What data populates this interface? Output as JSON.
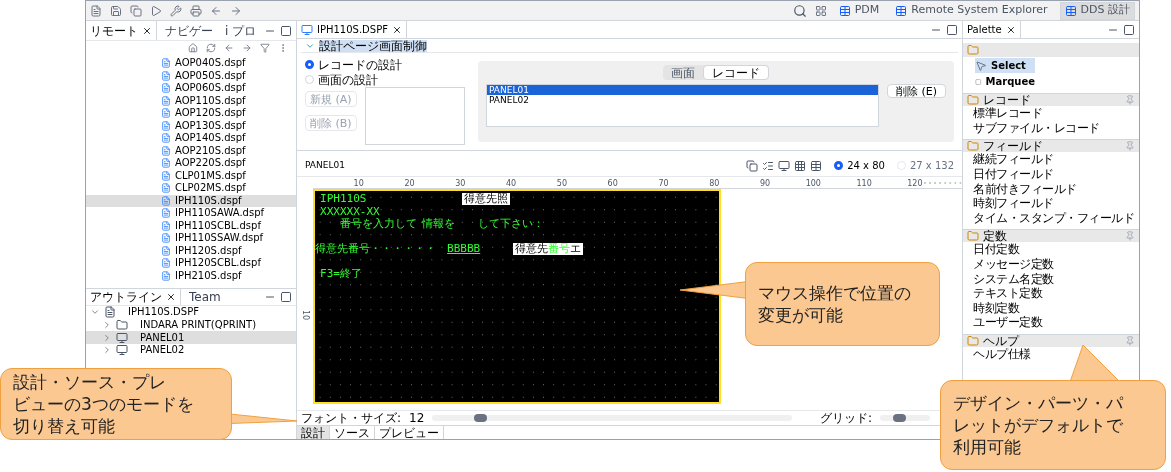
{
  "toolbar": {
    "perspectives": [
      {
        "label": "PDM",
        "selected": false
      },
      {
        "label": "Remote System Explorer",
        "selected": false
      },
      {
        "label": "DDS 設計",
        "selected": true
      }
    ]
  },
  "remote_panel": {
    "tabs": [
      {
        "label": "リモート",
        "selected": true
      },
      {
        "label": "ナビゲー",
        "selected": false
      },
      {
        "label": "i プロ",
        "selected": false
      }
    ],
    "files": [
      {
        "name": "AOP040S.dspf",
        "selected": false
      },
      {
        "name": "AOP050S.dspf",
        "selected": false
      },
      {
        "name": "AOP060S.dspf",
        "selected": false
      },
      {
        "name": "AOP110S.dspf",
        "selected": false
      },
      {
        "name": "AOP120S.dspf",
        "selected": false
      },
      {
        "name": "AOP130S.dspf",
        "selected": false
      },
      {
        "name": "AOP140S.dspf",
        "selected": false
      },
      {
        "name": "AOP210S.dspf",
        "selected": false
      },
      {
        "name": "AOP220S.dspf",
        "selected": false
      },
      {
        "name": "CLP01MS.dspf",
        "selected": false
      },
      {
        "name": "CLP02MS.dspf",
        "selected": false
      },
      {
        "name": "IPH110S.dspf",
        "selected": true
      },
      {
        "name": "IPH110SAWA.dspf",
        "selected": false
      },
      {
        "name": "IPH110SCBL.dspf",
        "selected": false
      },
      {
        "name": "IPH110SSAW.dspf",
        "selected": false
      },
      {
        "name": "IPH120S.dspf",
        "selected": false
      },
      {
        "name": "IPH120SCBL.dspf",
        "selected": false
      },
      {
        "name": "IPH210S.dspf",
        "selected": false
      }
    ]
  },
  "outline_panel": {
    "tabs": [
      {
        "label": "アウトライン",
        "selected": true
      },
      {
        "label": "Team",
        "selected": false
      }
    ],
    "tree": [
      {
        "label": "IPH110S.DSPF",
        "kind": "file",
        "expanded": true,
        "selected": false,
        "children": [
          {
            "label": "INDARA PRINT(QPRINT)",
            "kind": "folder",
            "expanded": false,
            "selected": false
          },
          {
            "label": "PANEL01",
            "kind": "record",
            "expanded": false,
            "selected": true
          },
          {
            "label": "PANEL02",
            "kind": "record",
            "expanded": false,
            "selected": false
          }
        ]
      }
    ]
  },
  "editor": {
    "tab": "IPH110S.DSPF",
    "section_title": "設計ページ画面制御",
    "design_modes": [
      {
        "label": "レコードの設計",
        "selected": true
      },
      {
        "label": "画面の設計",
        "selected": false
      }
    ],
    "left_buttons": [
      {
        "label": "新規 (A)",
        "disabled": true
      },
      {
        "label": "削除 (B)",
        "disabled": true
      }
    ],
    "view_tabs": [
      {
        "label": "画面",
        "selected": false
      },
      {
        "label": "レコード",
        "selected": true
      }
    ],
    "records": [
      {
        "name": "PANEL01",
        "selected": true
      },
      {
        "name": "PANEL02",
        "selected": false
      }
    ],
    "delete_button": "削除 (E)",
    "record_name": "PANEL01",
    "screen_sizes": [
      {
        "label": "24 x 80",
        "selected": true,
        "disabled": false
      },
      {
        "label": "27 x 132",
        "selected": false,
        "disabled": true
      }
    ],
    "ruler_labels": [
      "10",
      "20",
      "30",
      "40",
      "50",
      "60",
      "70",
      "80",
      "90",
      "100",
      "110",
      "120"
    ],
    "vertical_ruler_label": "10",
    "screen_fields": [
      {
        "text": "IPH110S",
        "kind": "constant"
      },
      {
        "text": "得意先照",
        "kind": "highlighted"
      },
      {
        "text": "XXXXXX-XX",
        "kind": "constant"
      },
      {
        "text": "番号を入力して",
        "kind": "constant"
      },
      {
        "text": "情報を",
        "kind": "constant"
      },
      {
        "text": "して下さい：",
        "kind": "constant"
      },
      {
        "text": "得意先番号・・・・・・",
        "kind": "constant"
      },
      {
        "text": "BBBBB",
        "kind": "input"
      },
      {
        "text": "得意先**番号**エ",
        "kind": "highlighted"
      },
      {
        "text": "F3=",
        "kind": "constant"
      },
      {
        "text": "終了",
        "kind": "constant"
      }
    ],
    "font_size_label": "フォント・サイズ:",
    "font_size_value": "12",
    "font_slider": {
      "level": 0.12
    },
    "grid_label": "グリッド:",
    "grid_slider": {
      "level": 0.35
    },
    "mode_tabs": [
      {
        "label": "設計",
        "selected": true
      },
      {
        "label": "ソース",
        "selected": false
      },
      {
        "label": "プレビュー",
        "selected": false
      }
    ]
  },
  "palette": {
    "title": "Palette",
    "tools": [
      {
        "label": "Select",
        "kind": "select",
        "selected": true
      },
      {
        "label": "Marquee",
        "kind": "marquee",
        "selected": false
      }
    ],
    "groups": [
      {
        "label": "レコード",
        "items": [
          "標準レコード",
          "サブファイル・レコード"
        ]
      },
      {
        "label": "フィールド",
        "items": [
          "継続フィールド",
          "日付フィールド",
          "名前付きフィールド",
          "時刻フィールド",
          "タイム・スタンプ・フィールド"
        ]
      },
      {
        "label": "定数",
        "items": [
          "日付定数",
          "メッセージ定数",
          "システム名定数",
          "テキスト定数",
          "時刻定数",
          "ユーザー定数"
        ]
      },
      {
        "label": "ヘルプ",
        "items": [
          "ヘルプ仕様"
        ]
      }
    ]
  },
  "callouts": [
    {
      "lines": [
        "設計・ソース・プレ",
        "ビューの3つのモードを",
        "切り替え可能"
      ]
    },
    {
      "lines": [
        "マウス操作で位置の",
        "変更が可能"
      ]
    },
    {
      "lines": [
        "デザイン・パーツ・パ",
        "レットがデフォルトで",
        "利用可能"
      ]
    }
  ]
}
